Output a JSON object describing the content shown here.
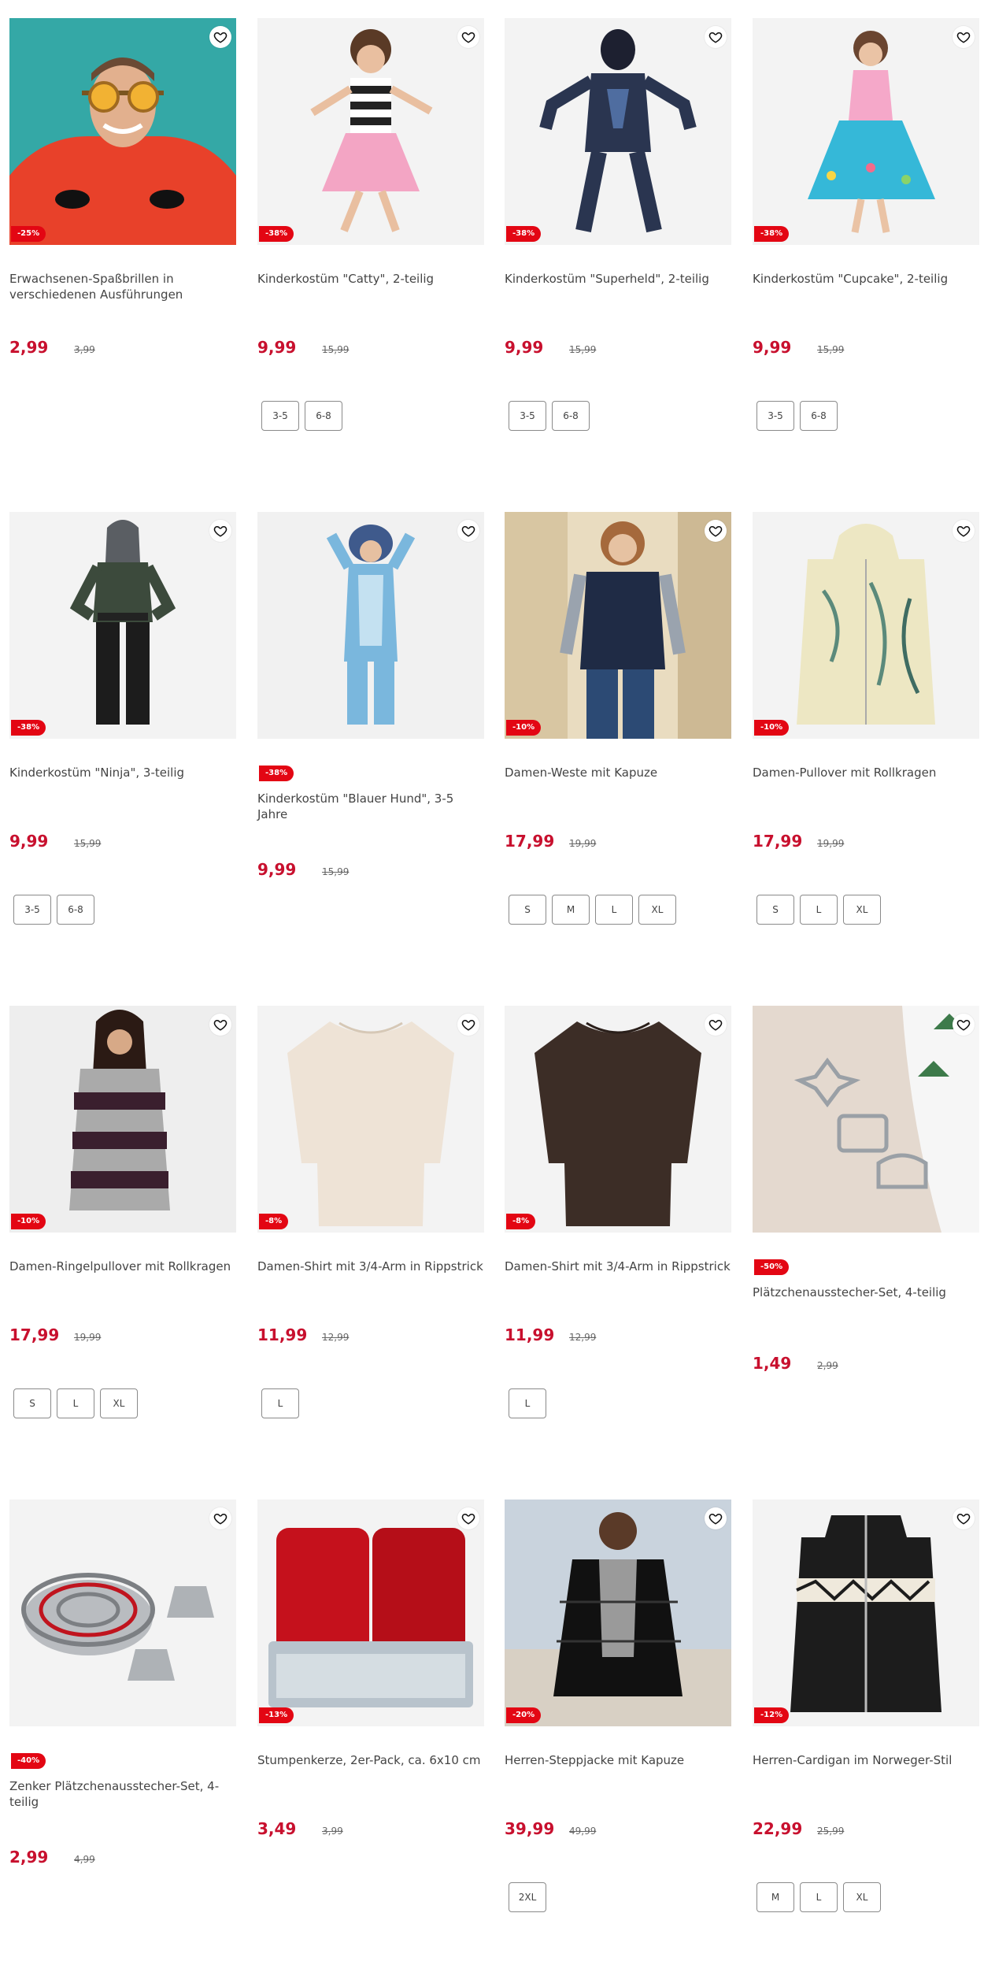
{
  "icons": {
    "wishlist": "heart-outline-icon"
  },
  "colors": {
    "price": "#c8102e",
    "badge": "#e30613"
  },
  "products": [
    {
      "title": "Erwachsenen-Spaßbrillen in verschiedenen Ausführungen",
      "discount": "-25%",
      "price": "2,99",
      "old_price": "3,99",
      "sizes": [],
      "image": "man-red-costume-funny-glasses"
    },
    {
      "title": "Kinderkostüm \"Catty\", 2-teilig",
      "discount": "-38%",
      "price": "9,99",
      "old_price": "15,99",
      "sizes": [
        "3-5",
        "6-8"
      ],
      "image": "girl-cat-costume"
    },
    {
      "title": "Kinderkostüm \"Superheld\", 2-teilig",
      "discount": "-38%",
      "price": "9,99",
      "old_price": "15,99",
      "sizes": [
        "3-5",
        "6-8"
      ],
      "image": "boy-superhero-costume"
    },
    {
      "title": "Kinderkostüm \"Cupcake\", 2-teilig",
      "discount": "-38%",
      "price": "9,99",
      "old_price": "15,99",
      "sizes": [
        "3-5",
        "6-8"
      ],
      "image": "girl-cupcake-dress"
    },
    {
      "title": "Kinderkostüm \"Ninja\", 3-teilig",
      "discount": "-38%",
      "price": "9,99",
      "old_price": "15,99",
      "sizes": [
        "3-5",
        "6-8"
      ],
      "image": "boy-ninja-costume"
    },
    {
      "title": "Kinderkostüm \"Blauer Hund\", 3-5 Jahre",
      "discount": "-38%",
      "price": "9,99",
      "old_price": "15,99",
      "sizes": [],
      "image": "child-blue-dog-onesie"
    },
    {
      "title": "Damen-Weste mit Kapuze",
      "discount": "-10%",
      "price": "17,99",
      "old_price": "19,99",
      "sizes": [
        "S",
        "M",
        "L",
        "XL"
      ],
      "image": "woman-quilted-vest"
    },
    {
      "title": "Damen-Pullover mit Rollkragen",
      "discount": "-10%",
      "price": "17,99",
      "old_price": "19,99",
      "sizes": [
        "S",
        "L",
        "XL"
      ],
      "image": "patterned-hoodie"
    },
    {
      "title": "Damen-Ringelpullover mit Rollkragen",
      "discount": "-10%",
      "price": "17,99",
      "old_price": "19,99",
      "sizes": [
        "S",
        "L",
        "XL"
      ],
      "image": "woman-striped-sweater"
    },
    {
      "title": "Damen-Shirt mit 3/4-Arm in Rippstrick",
      "discount": "-8%",
      "price": "11,99",
      "old_price": "12,99",
      "sizes": [
        "L"
      ],
      "image": "cream-shirt"
    },
    {
      "title": "Damen-Shirt mit 3/4-Arm in Rippstrick",
      "discount": "-8%",
      "price": "11,99",
      "old_price": "12,99",
      "sizes": [
        "L"
      ],
      "image": "brown-shirt"
    },
    {
      "title": "Plätzchenausstecher-Set, 4-teilig",
      "discount": "-50%",
      "price": "1,49",
      "old_price": "2,99",
      "sizes": [],
      "image": "cookie-cutters-on-table"
    },
    {
      "title": "Zenker Plätzchenausstecher-Set, 4-teilig",
      "discount": "-40%",
      "price": "2,99",
      "old_price": "4,99",
      "sizes": [],
      "image": "round-cookie-cutters"
    },
    {
      "title": "Stumpenkerze, 2er-Pack, ca. 6x10 cm",
      "discount": "-13%",
      "price": "3,49",
      "old_price": "3,99",
      "sizes": [],
      "image": "red-candles-pack"
    },
    {
      "title": "Herren-Steppjacke mit Kapuze",
      "discount": "-20%",
      "price": "39,99",
      "old_price": "49,99",
      "sizes": [
        "2XL"
      ],
      "image": "man-puffer-jacket"
    },
    {
      "title": "Herren-Cardigan im Norweger-Stil",
      "discount": "-12%",
      "price": "22,99",
      "old_price": "25,99",
      "sizes": [
        "M",
        "L",
        "XL"
      ],
      "image": "norwegian-cardigan"
    }
  ]
}
